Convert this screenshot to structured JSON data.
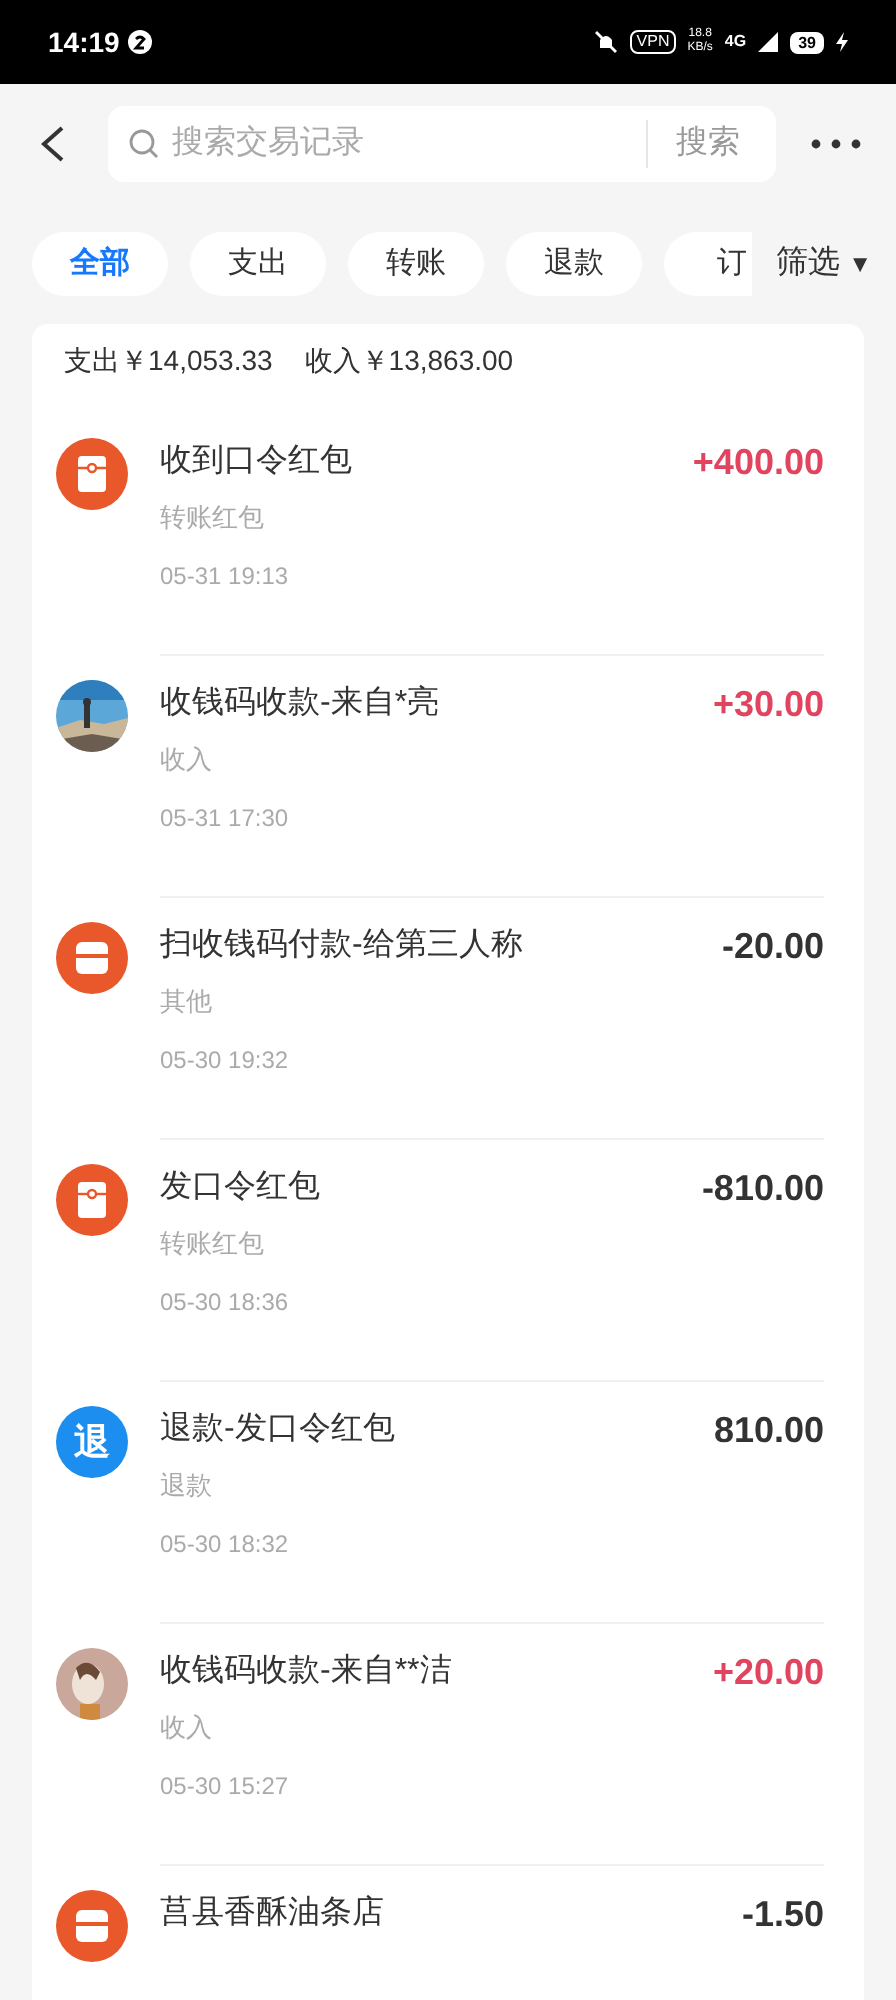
{
  "status_bar": {
    "time": "14:19",
    "vpn": "VPN",
    "speed": "18.8",
    "speed_unit": "KB/s",
    "network": "4G",
    "battery": "39"
  },
  "search": {
    "placeholder": "搜索交易记录",
    "button": "搜索"
  },
  "tabs": [
    {
      "label": "全部",
      "selected": true
    },
    {
      "label": "支出",
      "selected": false
    },
    {
      "label": "转账",
      "selected": false
    },
    {
      "label": "退款",
      "selected": false
    },
    {
      "label": "订",
      "selected": false
    }
  ],
  "filter": {
    "label": "筛选",
    "caret": "▼"
  },
  "summary": {
    "expense": "支出￥14,053.33",
    "income": "收入￥13,863.00"
  },
  "transactions": [
    {
      "icon": {
        "kind": "packet"
      },
      "title": "收到口令红包",
      "category": "转账红包",
      "time": "05-31 19:13",
      "amount": "+400.00",
      "income": true
    },
    {
      "title": "收钱码收款-来自*亮",
      "category": "收入",
      "time": "05-31 17:30",
      "amount": "+30.00",
      "income": true
    },
    {
      "icon": {
        "kind": "shop"
      },
      "title": "扫收钱码付款-给第三人称",
      "category": "其他",
      "time": "05-30 19:32",
      "amount": "-20.00",
      "income": false
    },
    {
      "icon": {
        "kind": "packet"
      },
      "title": "发口令红包",
      "category": "转账红包",
      "time": "05-30 18:36",
      "amount": "-810.00",
      "income": false
    },
    {
      "icon": {
        "kind": "glyph",
        "text": "退"
      },
      "title": "退款-发口令红包",
      "category": "退款",
      "time": "05-30 18:32",
      "amount": "810.00",
      "income": false
    },
    {
      "icon": {
        "kind": "picture2"
      },
      "title": "收钱码收款-来自**洁",
      "category": "收入",
      "time": "05-30 15:27",
      "amount": "+20.00",
      "income": true
    },
    {
      "icon": {
        "kind": "shop"
      },
      "title": "莒县香酥油条店",
      "amount": "-1.50",
      "income": false
    }
  ]
}
